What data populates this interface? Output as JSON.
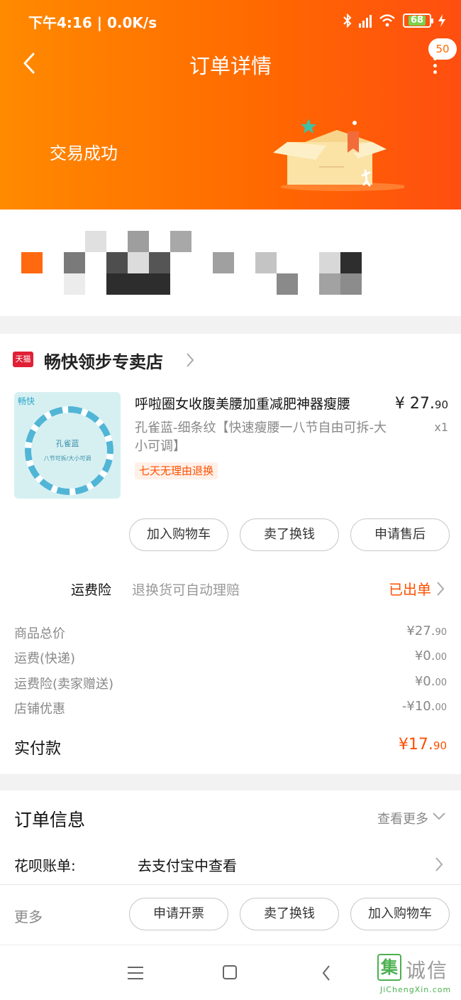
{
  "status_bar": {
    "time": "下午4:16 | 0.0K/s",
    "battery": "68"
  },
  "header": {
    "title": "订单详情",
    "badge": "50"
  },
  "order_status": "交易成功",
  "store": {
    "logo_text": "天猫",
    "name": "畅快领步专卖店"
  },
  "product": {
    "thumb_brand": "畅快",
    "thumb_name": "孔雀蓝",
    "thumb_sub": "八节可拆/大小可调",
    "title": "呼啦圈女收腹美腰加重减肥神器瘦腰",
    "sku": "孔雀蓝-细条纹【快速瘦腰一八节自由可拆-大小可调】",
    "return_policy": "七天无理由退换",
    "price_main": "¥ 27.",
    "price_dec": "90",
    "quantity": "x1"
  },
  "item_actions": [
    "加入购物车",
    "卖了换钱",
    "申请售后"
  ],
  "insurance": {
    "label": "运费险",
    "desc": "退换货可自动理赔",
    "status": "已出单"
  },
  "fees": [
    {
      "label": "商品总价",
      "value": "¥27.",
      "dec": "90"
    },
    {
      "label": "运费(快递)",
      "value": "¥0.",
      "dec": "00"
    },
    {
      "label": "运费险(卖家赠送)",
      "value": "¥0.",
      "dec": "00"
    },
    {
      "label": "店铺优惠",
      "value": "-¥10.",
      "dec": "00"
    }
  ],
  "paid": {
    "label": "实付款",
    "value": "¥17.",
    "dec": "90"
  },
  "order_info": {
    "title": "订单信息",
    "see_more": "查看更多",
    "huabei_label": "花呗账单:",
    "huabei_value": "去支付宝中查看",
    "more_label": "更多"
  },
  "bottom_actions": [
    "申请开票",
    "卖了换钱",
    "加入购物车"
  ],
  "watermark": {
    "glyph": "集",
    "name": "诚信",
    "url": "JiChengXin.com"
  },
  "colors": {
    "accent": "#ff5000",
    "header_gradient_start": "#ff8a00",
    "header_gradient_end": "#ff4e10"
  }
}
